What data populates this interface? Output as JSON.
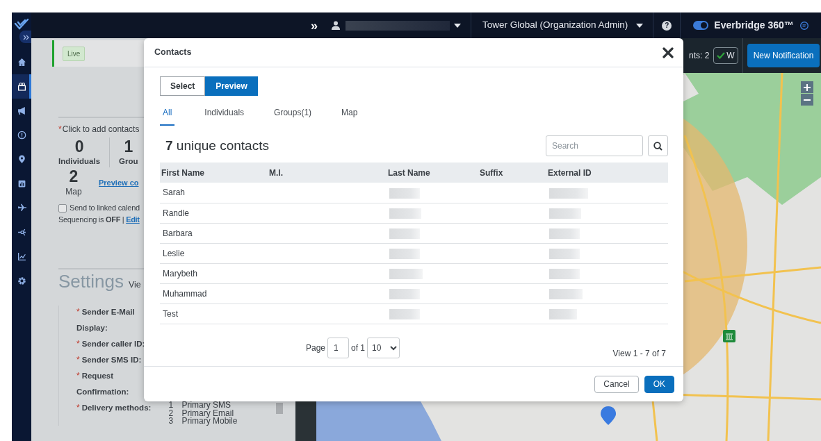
{
  "sidebar": {
    "items": [
      {
        "selected": false
      },
      {
        "selected": true
      },
      {
        "selected": false
      },
      {
        "selected": false
      },
      {
        "selected": false
      },
      {
        "selected": false
      },
      {
        "selected": false
      },
      {
        "selected": false
      },
      {
        "selected": false
      },
      {
        "selected": false
      }
    ]
  },
  "navbar": {
    "expand": "»",
    "help": "?",
    "organization": "Tower Global (Organization Admin)",
    "product": "Everbridge 360™",
    "product_toggle_on": true
  },
  "page": {
    "status_badge": "Live",
    "contacts_summary": {
      "required_marker": "*",
      "prompt": "Click to add contacts",
      "counts": [
        {
          "value": "0",
          "label": "Individuals"
        },
        {
          "value": "1",
          "label": "Grou"
        }
      ],
      "map_count": {
        "value": "2",
        "label": "Map"
      },
      "preview_link": "Preview co",
      "linked_calendar": {
        "label": "Send to linked calend",
        "checked": false
      },
      "sequencing": "Sequencing is **OFF** |",
      "sequencing_link": "Edit"
    },
    "settings": {
      "title": "Settings",
      "link": "Vie",
      "fields": [
        {
          "marker": "*",
          "label": "Sender E-Mail"
        },
        {
          "label": "Display:"
        },
        {
          "marker": "*",
          "label": "Sender caller ID:"
        },
        {
          "marker": "*",
          "label": "Sender SMS ID:"
        },
        {
          "marker": "*",
          "label": "Request"
        },
        {
          "label": "Confirmation:"
        },
        {
          "marker": "*",
          "label": "Delivery methods:"
        }
      ],
      "delivery_methods": [
        {
          "number": "1",
          "name": "Primary SMS"
        },
        {
          "number": "2",
          "name": "Primary Email"
        },
        {
          "number": "3",
          "name": "Primary Mobile"
        }
      ]
    }
  },
  "toolbar": {
    "events_count": "nts: 2",
    "filter_chip": {
      "label": "W",
      "checked": true
    },
    "new_button": "New Notification"
  },
  "modal": {
    "title": "Contacts",
    "mode_buttons": [
      {
        "label": "Select",
        "selected": false
      },
      {
        "label": "Preview",
        "selected": true
      }
    ],
    "tabs": [
      {
        "label": "All",
        "selected": true
      },
      {
        "label": "Individuals",
        "selected": false
      },
      {
        "label": "Groups(1)",
        "selected": false
      },
      {
        "label": "Map",
        "selected": false
      }
    ],
    "heading": "**7** unique contacts",
    "search": {
      "placeholder": "Search"
    },
    "table": {
      "columns": [
        "First Name",
        "M.I.",
        "Last Name",
        "Suffix",
        "External ID"
      ],
      "rows": [
        {
          "first_name": "Sarah"
        },
        {
          "first_name": "Randle"
        },
        {
          "first_name": "Barbara"
        },
        {
          "first_name": "Leslie"
        },
        {
          "first_name": "Marybeth"
        },
        {
          "first_name": "Muhammad"
        },
        {
          "first_name": "Test"
        }
      ]
    },
    "pager": {
      "page_label": "Page",
      "page": "1",
      "of_label": "of 1",
      "page_size": "10",
      "view": "View 1 - 7 of 7"
    },
    "buttons": [
      {
        "label": "Cancel",
        "kind": "secondary"
      },
      {
        "label": "OK",
        "kind": "primary"
      }
    ]
  }
}
